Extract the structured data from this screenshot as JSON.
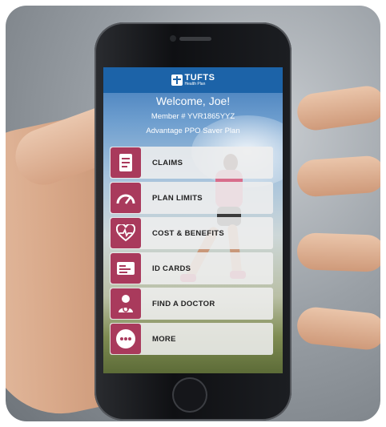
{
  "app": {
    "logo_name": "TUFTS",
    "logo_sub": "Health Plan"
  },
  "welcome": "Welcome, Joe!",
  "member_line": "Member # YVR1865YYZ",
  "plan_line": "Advantage PPO Saver Plan",
  "menu": {
    "items": [
      {
        "label": "CLAIMS",
        "icon": "claims-document-icon"
      },
      {
        "label": "PLAN LIMITS",
        "icon": "gauge-icon"
      },
      {
        "label": "COST & BENEFITS",
        "icon": "heart-pulse-icon"
      },
      {
        "label": "ID CARDS",
        "icon": "id-card-icon"
      },
      {
        "label": "FIND A DOCTOR",
        "icon": "doctor-icon"
      },
      {
        "label": "MORE",
        "icon": "more-dots-icon"
      }
    ]
  },
  "colors": {
    "header_blue": "#1c63a8",
    "tile_maroon": "#a93a5c"
  }
}
